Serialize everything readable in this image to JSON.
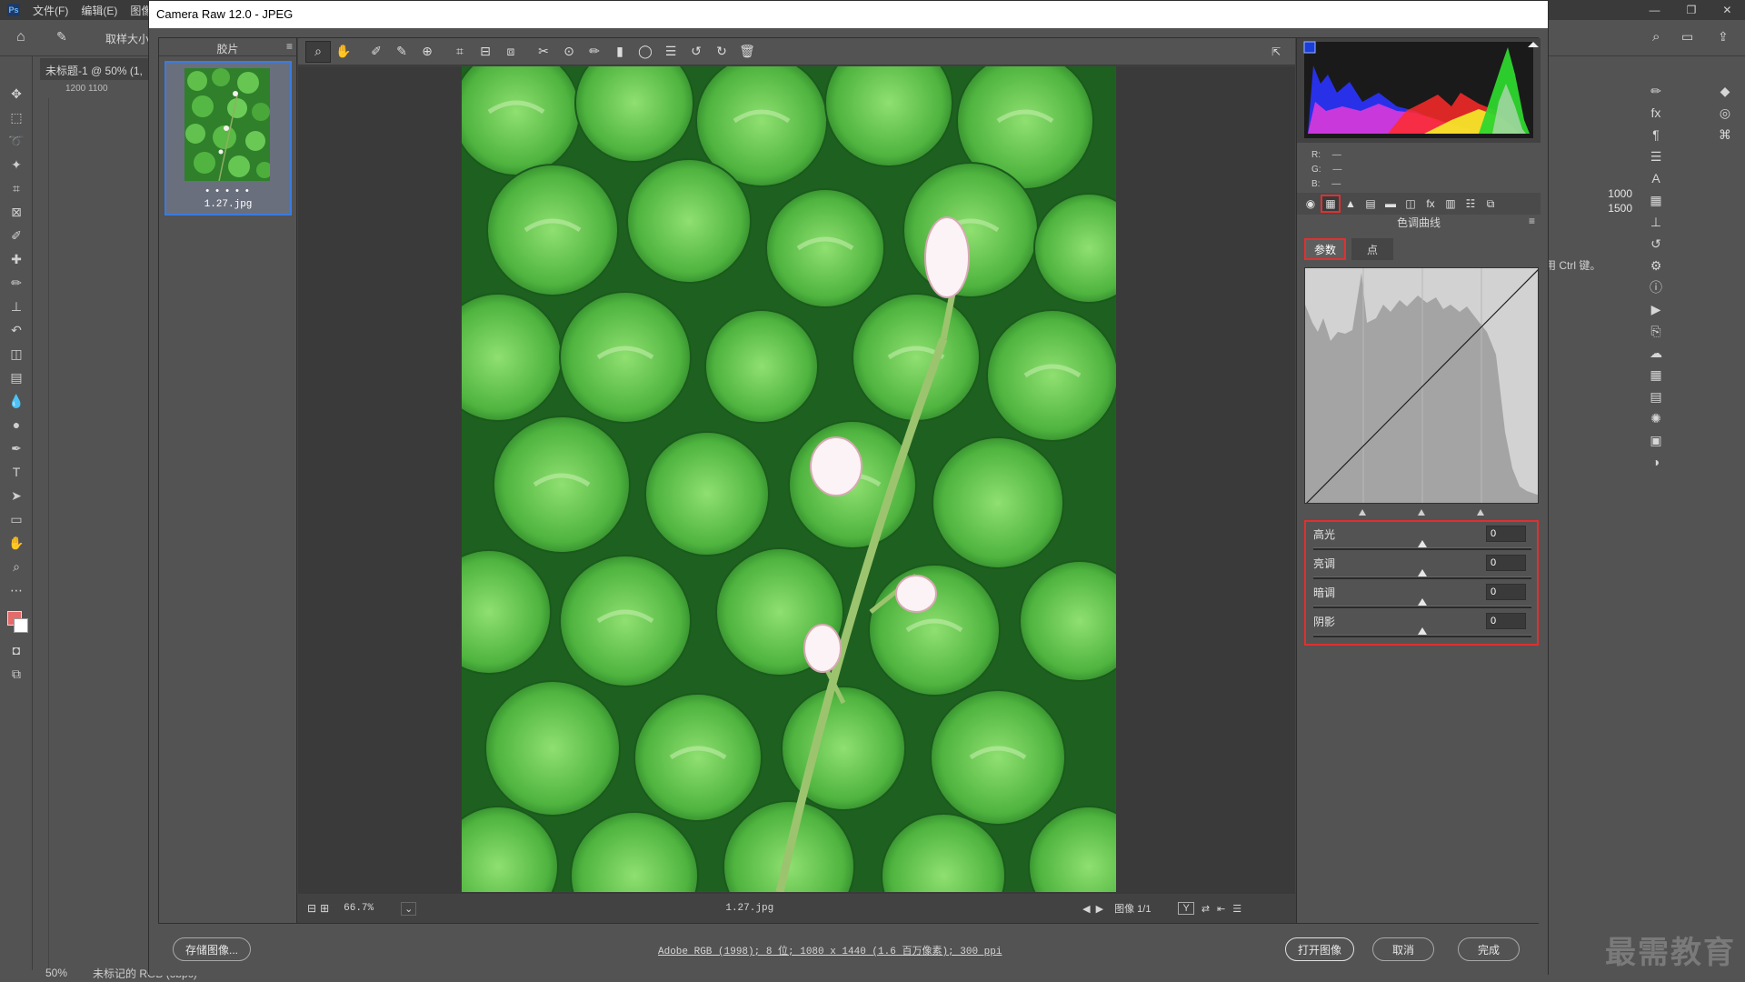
{
  "ps": {
    "logo": "Ps",
    "menus": [
      "文件(F)",
      "编辑(E)",
      "图像(I"
    ],
    "options_label": "取样大小",
    "doc_tab": "未标题-1 @ 50% (1,",
    "ruler_h": "1200   1100",
    "zoom": "50%",
    "status_text": "未标记的 RGB (8bpc)",
    "right_numbers": [
      "1000",
      "1500"
    ],
    "right_hint": "用 Ctrl 键。",
    "watermark": "最需教育"
  },
  "dialog": {
    "title": "Camera Raw 12.0  -  JPEG",
    "filmstrip_title": "胶片",
    "thumb_stars": "• • • • •",
    "thumb_name": "1.27.jpg",
    "preview_zoom": "66.7%",
    "preview_filename": "1.27.jpg",
    "image_counter": "图像 1/1",
    "panel_title": "色调曲线",
    "subtabs": [
      "参数",
      "点"
    ],
    "rgb_labels": [
      "R:",
      "G:",
      "B:"
    ],
    "rgb_values": [
      "—",
      "—",
      "—"
    ],
    "sliders": [
      {
        "label": "高光",
        "value": "0"
      },
      {
        "label": "亮调",
        "value": "0"
      },
      {
        "label": "暗调",
        "value": "0"
      },
      {
        "label": "阴影",
        "value": "0"
      }
    ],
    "footer": {
      "save_label": "存储图像...",
      "info_link": "Adobe RGB (1998); 8 位; 1080 x 1440 (1.6 百万像素); 300 ppi",
      "open_label": "打开图像",
      "cancel_label": "取消",
      "done_label": "完成"
    }
  },
  "colors": {
    "accent_red": "#e03030",
    "selection_blue": "#3b7be0"
  }
}
